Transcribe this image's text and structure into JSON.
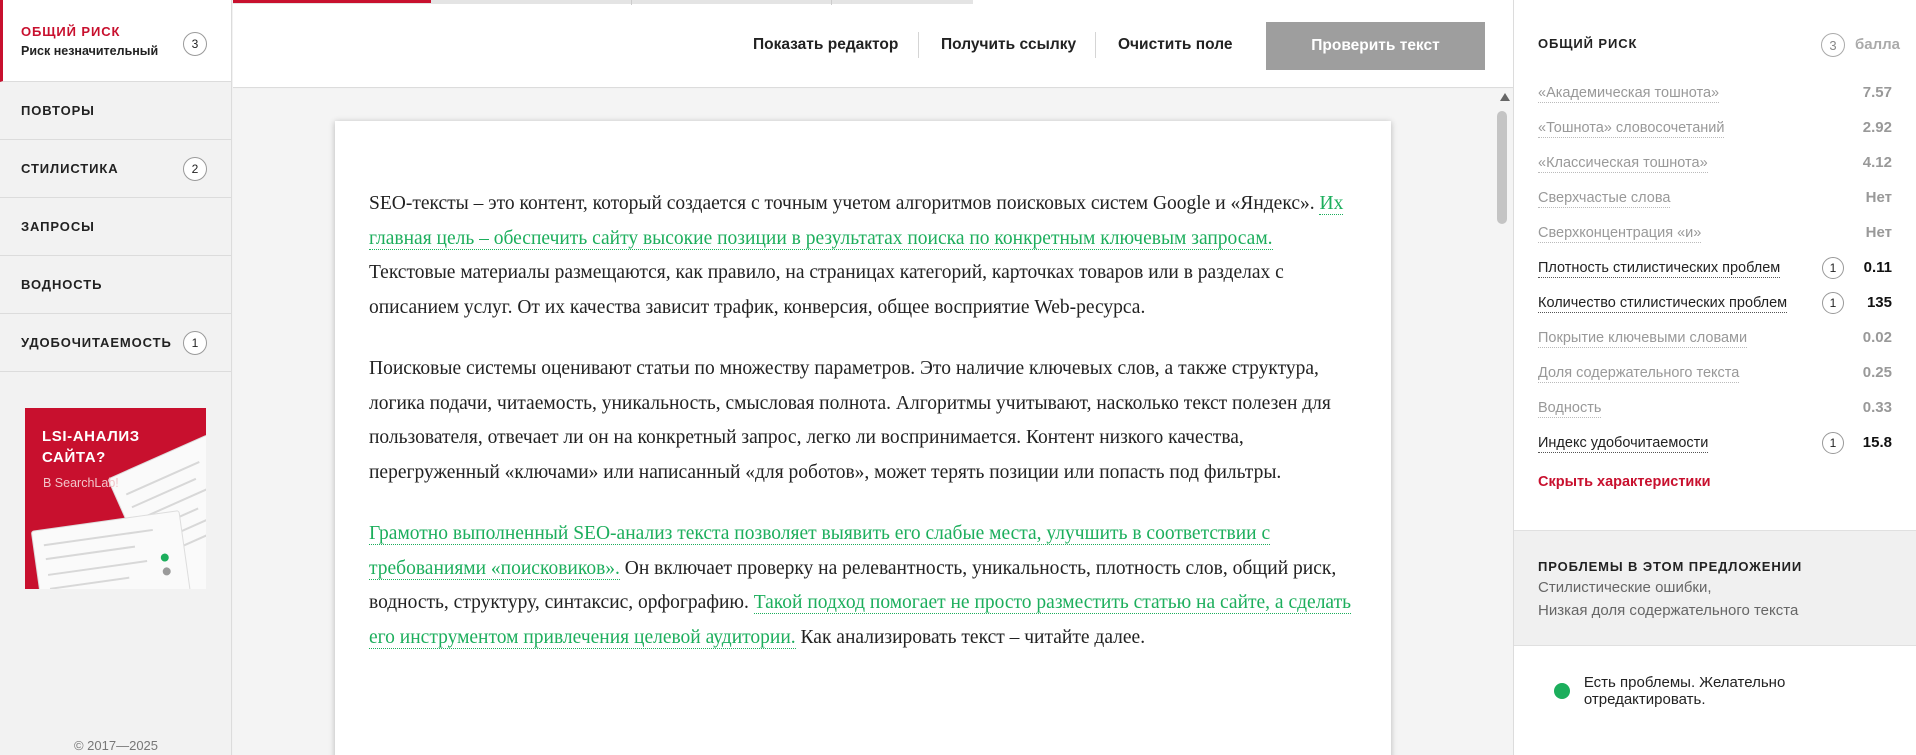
{
  "sidebar": {
    "items": [
      {
        "label": "ОБЩИЙ РИСК",
        "sub": "Риск незначительный",
        "badge": "3"
      },
      {
        "label": "ПОВТОРЫ",
        "badge": ""
      },
      {
        "label": "СТИЛИСТИКА",
        "badge": "2"
      },
      {
        "label": "ЗАПРОСЫ",
        "badge": ""
      },
      {
        "label": "ВОДНОСТЬ",
        "badge": ""
      },
      {
        "label": "УДОБОЧИТАЕМОСТЬ",
        "badge": "1"
      }
    ],
    "promo": {
      "title_line1": "LSI-АНАЛИЗ",
      "title_line2": "САЙТА?",
      "subtitle": "В SearchLab!"
    },
    "copyright": "© 2017—2025"
  },
  "toolbar": {
    "show_editor": "Показать редактор",
    "get_link": "Получить ссылку",
    "clear_field": "Очистить поле",
    "check_text": "Проверить текст"
  },
  "editor": {
    "p1": {
      "t1": "SEO-тексты – это контент, который создается с точным учетом алгоритмов поисковых систем Google и «Яндекс». ",
      "h1": "Их главная цель – обеспечить сайту высокие позиции в результатах поиска по конкретным ключевым запросам.",
      "t2": " Текстовые материалы размещаются, как правило, на страницах категорий, карточках товаров или в разделах с описанием услуг. От их качества зависит трафик, конверсия, общее восприятие Web-ресурса."
    },
    "p2": "Поисковые системы оценивают статьи по множеству параметров. Это наличие ключевых слов, а также структура, логика подачи, читаемость, уникальность, смысловая полнота. Алгоритмы учитывают, насколько текст полезен для пользователя, отвечает ли он на конкретный запрос, легко ли воспринимается. Контент низкого качества, перегруженный «ключами» или написанный «для роботов», может терять позиции или попасть под фильтры.",
    "p3": {
      "h1": "Грамотно выполненный SEO-анализ текста позволяет выявить его слабые места, улучшить в соответствии с требованиями «поисковиков».",
      "t1": " Он включает проверку на релевантность, уникальность, плотность слов, общий риск, водность, структуру, синтаксис, орфографию. ",
      "h2": "Такой подход помогает не просто разместить статью на сайте, а сделать его инструментом привлечения целевой аудитории.",
      "t2": " Как анализировать текст – читайте далее."
    }
  },
  "panel": {
    "title": "ОБЩИЙ РИСК",
    "score": "3",
    "unit": "балла",
    "metrics": [
      {
        "label": "«Академическая тошнота»",
        "value": "7.57",
        "badge": "",
        "active": false
      },
      {
        "label": "«Тошнота» словосочетаний",
        "value": "2.92",
        "badge": "",
        "active": false
      },
      {
        "label": "«Классическая тошнота»",
        "value": "4.12",
        "badge": "",
        "active": false
      },
      {
        "label": "Сверхчастые слова",
        "value": "Нет",
        "badge": "",
        "active": false
      },
      {
        "label": "Сверхконцентрация «и»",
        "value": "Нет",
        "badge": "",
        "active": false
      },
      {
        "label": "Плотность стилистических проблем",
        "value": "0.11",
        "badge": "1",
        "active": true
      },
      {
        "label": "Количество стилистических проблем",
        "value": "135",
        "badge": "1",
        "active": true
      },
      {
        "label": "Покрытие ключевыми словами",
        "value": "0.02",
        "badge": "",
        "active": false
      },
      {
        "label": "Доля содержательного текста",
        "value": "0.25",
        "badge": "",
        "active": false
      },
      {
        "label": "Водность",
        "value": "0.33",
        "badge": "",
        "active": false
      },
      {
        "label": "Индекс удобочитаемости",
        "value": "15.8",
        "badge": "1",
        "active": true
      }
    ],
    "hide_link": "Скрыть характеристики",
    "problems": {
      "title": "ПРОБЛЕМЫ В ЭТОМ ПРЕДЛОЖЕНИИ",
      "items": [
        "Стилистические ошибки,",
        "Низкая доля содержательного текста"
      ]
    },
    "status": {
      "text": "Есть проблемы. Желательно отредактировать.",
      "color": "#1cae5c"
    }
  },
  "colors": {
    "accent": "#c8102e",
    "highlight": "#1cae5c",
    "button": "#9e9e9e"
  }
}
